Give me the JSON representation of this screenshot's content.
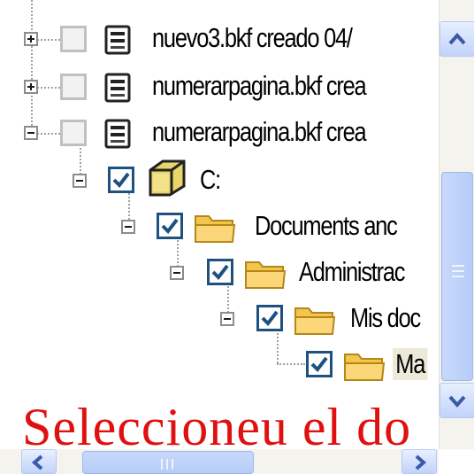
{
  "tree": {
    "items": [
      {
        "label": "nuevo3.bkf creado 04/",
        "expander": "plus",
        "checked": false,
        "icon": "backup-file-icon"
      },
      {
        "label": "numerarpagina.bkf crea",
        "expander": "plus",
        "checked": false,
        "icon": "backup-file-icon"
      },
      {
        "label": "numerarpagina.bkf crea",
        "expander": "minus",
        "checked": false,
        "icon": "backup-file-icon"
      },
      {
        "label": "C:",
        "expander": "minus",
        "checked": true,
        "icon": "drive-folder-icon"
      },
      {
        "label": "Documents anc",
        "expander": "minus",
        "checked": true,
        "icon": "folder-icon"
      },
      {
        "label": "Administrac",
        "expander": "minus",
        "checked": true,
        "icon": "folder-icon"
      },
      {
        "label": "Mis doc",
        "expander": "minus",
        "checked": true,
        "icon": "folder-icon"
      },
      {
        "label": "Ma",
        "expander": "none",
        "checked": true,
        "icon": "folder-icon",
        "selected": true
      }
    ]
  },
  "overlay_text": "Seleccioneu el do",
  "colors": {
    "overlay": "#e01010",
    "check": "#1c5180",
    "folder": "#f3c44e"
  }
}
